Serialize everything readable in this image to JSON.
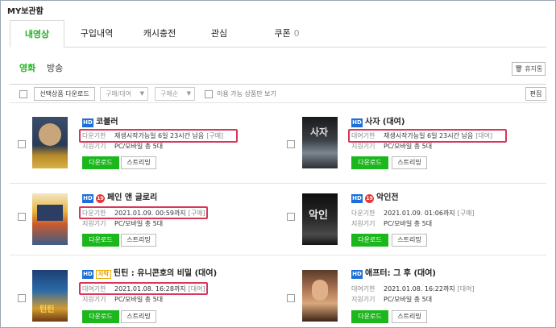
{
  "header": {
    "title": "MY보관함"
  },
  "tabs": [
    {
      "label": "내영상",
      "count": ""
    },
    {
      "label": "구입내역",
      "count": ""
    },
    {
      "label": "캐시충전",
      "count": ""
    },
    {
      "label": "관심",
      "count": ""
    },
    {
      "label": "쿠폰",
      "count": "0"
    }
  ],
  "subtabs": [
    {
      "label": "영화"
    },
    {
      "label": "방송"
    }
  ],
  "trash_label": "휴지통",
  "toolbar": {
    "download_selected": "선택상품 다운로드",
    "filter_type": "구매/대여",
    "filter_sort": "구매순",
    "available_only": "이용 가능 상품만 보기",
    "edit": "편집"
  },
  "items": [
    {
      "hd": "HD",
      "age19": "",
      "sub": "",
      "title": "코블러",
      "label1": "다운기한",
      "value1": "재생시작가능일 6일 23시간 남음",
      "type": "[구매]",
      "label2": "지원기기",
      "value2": "PC/모바일 총 5대",
      "download": "다운로드",
      "stream": "스트리밍"
    },
    {
      "hd": "HD",
      "age19": "",
      "sub": "",
      "title": "사자 (대여)",
      "label1": "대여기한",
      "value1": "재생시작가능일 6일 23시간 남음",
      "type": "[대여]",
      "label2": "지원기기",
      "value2": "PC/모바일 총 5대",
      "download": "다운로드",
      "stream": "스트리밍"
    },
    {
      "hd": "HD",
      "age19": "19",
      "sub": "",
      "title": "페인 앤 글로리",
      "label1": "다운기한",
      "value1": "2021.01.09. 00:59까지",
      "type": "[구매]",
      "label2": "지원기기",
      "value2": "PC/모바일 총 5대",
      "download": "다운로드",
      "stream": "스트리밍"
    },
    {
      "hd": "HD",
      "age19": "19",
      "sub": "",
      "title": "악인전",
      "label1": "다운기한",
      "value1": "2021.01.09. 01:06까지",
      "type": "[구매]",
      "label2": "지원기기",
      "value2": "PC/모바일 총 5대",
      "download": "다운로드",
      "stream": "스트리밍"
    },
    {
      "hd": "HD",
      "age19": "",
      "sub": "자막",
      "title": "틴틴 : 유니콘호의 비밀 (대여)",
      "label1": "대여기한",
      "value1": "2021.01.08. 16:28까지",
      "type": "[대여]",
      "label2": "지원기기",
      "value2": "PC/모바일 총 5대",
      "download": "다운로드",
      "stream": "스트리밍"
    },
    {
      "hd": "HD",
      "age19": "",
      "sub": "",
      "title": "애프터: 그 후 (대여)",
      "label1": "대여기한",
      "value1": "2021.01.08. 16:22까지",
      "type": "[대여]",
      "label2": "지원기기",
      "value2": "PC/모바일 총 5대",
      "download": "다운로드",
      "stream": "스트리밍"
    }
  ],
  "colors": {
    "accent": "#1db21d",
    "highlight": "#d7375b",
    "hd_badge": "#1c6ed8"
  }
}
